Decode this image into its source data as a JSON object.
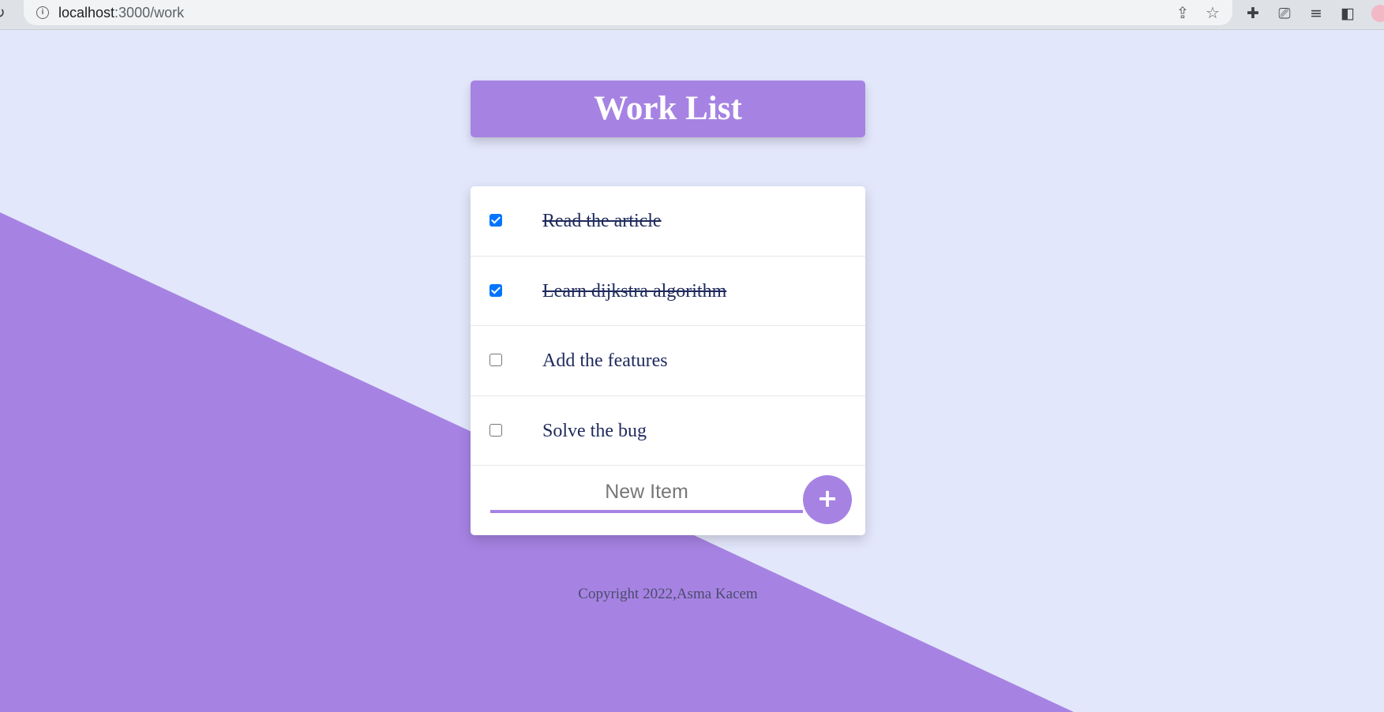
{
  "browser": {
    "url_host": "localhost",
    "url_path": ":3000/work",
    "info_icon": "info-icon",
    "icons": [
      "share-icon",
      "star-icon",
      "puzzle-icon",
      "cast-icon",
      "media-queue-icon",
      "side-panel-icon"
    ]
  },
  "colors": {
    "accent": "#A683E3",
    "background": "#E3E7FB",
    "checkbox": "#0075FF",
    "text": "#1F2A5C"
  },
  "header": {
    "title": "Work List"
  },
  "items": [
    {
      "label": "Read the article",
      "checked": true
    },
    {
      "label": "Learn dijkstra algorithm",
      "checked": true
    },
    {
      "label": "Add the features",
      "checked": false
    },
    {
      "label": "Solve the bug",
      "checked": false
    }
  ],
  "new_item": {
    "placeholder": "New Item",
    "add_label": "+"
  },
  "footer": {
    "copyright": "Copyright 2022,Asma Kacem"
  }
}
